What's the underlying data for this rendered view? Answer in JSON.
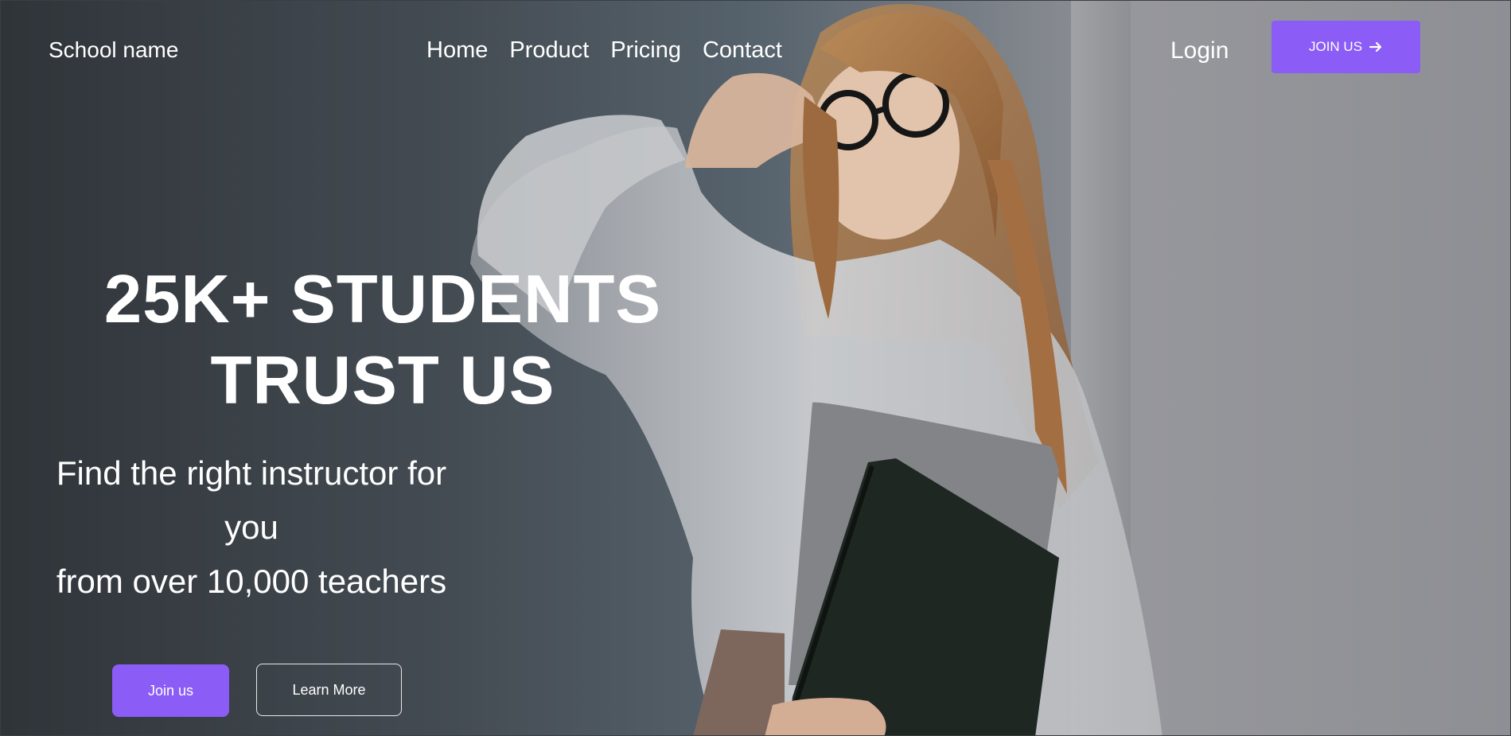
{
  "brand": {
    "name": "School name"
  },
  "nav": {
    "items": [
      {
        "label": "Home"
      },
      {
        "label": "Product"
      },
      {
        "label": "Pricing"
      },
      {
        "label": "Contact"
      }
    ],
    "login_label": "Login",
    "join_label": "JOIN US",
    "join_icon": "arrow-right-icon"
  },
  "hero": {
    "headline_line1": "25K+ STUDENTS",
    "headline_line2": "TRUST US",
    "subtitle_line1": "Find the right instructor for",
    "subtitle_line2": "you",
    "subtitle_line3": "from over 10,000 teachers",
    "primary_button": "Join us",
    "secondary_button": "Learn More"
  },
  "colors": {
    "accent": "#8b5cf6",
    "text": "#ffffff"
  }
}
